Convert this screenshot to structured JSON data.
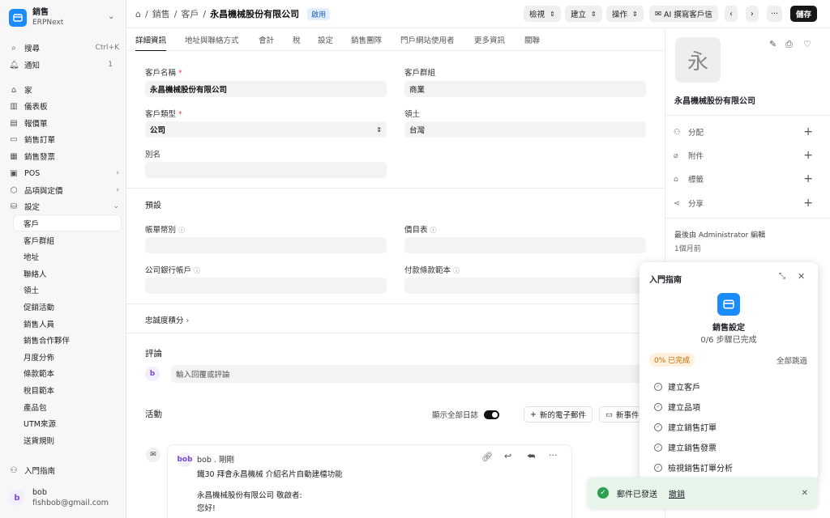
{
  "app": {
    "name": "銷售",
    "sub": "ERPNext"
  },
  "sidebar": {
    "search": {
      "label": "搜尋",
      "shortcut": "Ctrl+K"
    },
    "notify": {
      "label": "通知",
      "count": "1"
    },
    "items": [
      {
        "label": "家",
        "icon": "home-icon"
      },
      {
        "label": "儀表板",
        "icon": "chart-icon"
      },
      {
        "label": "報價單",
        "icon": "document-icon"
      },
      {
        "label": "銷售訂單",
        "icon": "order-icon"
      },
      {
        "label": "銷售發票",
        "icon": "invoice-icon"
      },
      {
        "label": "POS",
        "icon": "pos-icon"
      },
      {
        "label": "品項與定價",
        "icon": "box-icon"
      },
      {
        "label": "設定",
        "icon": "database-icon"
      }
    ],
    "subitems": [
      "客戶",
      "客戶群組",
      "地址",
      "聯絡人",
      "領土",
      "促銷活動",
      "銷售人員",
      "銷售合作夥伴",
      "月度分佈",
      "條款範本",
      "稅目範本",
      "產品包",
      "UTM來源",
      "送貨規則"
    ],
    "guide": "入門指南",
    "user": {
      "initial": "b",
      "name": "bob",
      "email": "fishbob@gmail.com"
    }
  },
  "header": {
    "crumbs": [
      "銷售",
      "客戶"
    ],
    "title": "永昌機械股份有限公司",
    "status": "啟用",
    "buttons": {
      "view": "檢視",
      "create": "建立",
      "actions": "操作",
      "ai": "AI 撰寫客戶信",
      "more": "···",
      "save": "儲存"
    }
  },
  "tabs": [
    "詳細資訊",
    "地址與聯絡方式",
    "會計",
    "稅",
    "設定",
    "銷售團隊",
    "門戶網站使用者",
    "更多資訊",
    "關聯"
  ],
  "form": {
    "customer_name_label": "客戶名稱",
    "customer_name": "永昌機械股份有限公司",
    "customer_group_label": "客戶群組",
    "customer_group": "商業",
    "customer_type_label": "客戶類型",
    "customer_type": "公司",
    "territory_label": "領土",
    "territory": "台灣",
    "alias_label": "別名",
    "defaults_title": "預設",
    "currency_label": "帳單幣別",
    "price_list_label": "價目表",
    "bank_label": "公司銀行帳戶",
    "payment_terms_label": "付款條款範本",
    "loyalty": "忠誠度積分",
    "comment_title": "評論",
    "comment_placeholder": "輸入回覆或評論",
    "activity_title": "活動",
    "show_all_logs": "顯示全部日誌",
    "new_email": "新的電子郵件",
    "new_event": "新事件"
  },
  "email_card": {
    "author": "bob",
    "time": "剛剛",
    "subject": "鐵30 拜會永昌機械 介紹名片自動建檔功能",
    "greeting": "永昌機械股份有限公司 敬啟者:",
    "line2": "您好!"
  },
  "right_panel": {
    "initial": "永",
    "name": "永昌機械股份有限公司",
    "rows": [
      {
        "label": "分配",
        "icon": "users-icon"
      },
      {
        "label": "附件",
        "icon": "paperclip-icon"
      },
      {
        "label": "標籤",
        "icon": "tag-icon"
      },
      {
        "label": "分享",
        "icon": "share-icon"
      }
    ],
    "edited_by": "最後由 Administrator 編輯",
    "edited_time": "1個月前"
  },
  "guide": {
    "title": "入門指南",
    "heading": "銷售設定",
    "progress": "0/6 步驟已完成",
    "pct_badge": "0% 已完成",
    "skip": "全部跳過",
    "steps": [
      "建立客戶",
      "建立品項",
      "建立銷售訂單",
      "建立銷售發票",
      "檢視銷售訂單分析"
    ]
  },
  "toast": {
    "message": "郵件已發送",
    "undo": "撤銷"
  },
  "colors": {
    "accent": "#1a8cff",
    "success": "#2e9e4f",
    "toast_bg": "#e6f4ea"
  }
}
